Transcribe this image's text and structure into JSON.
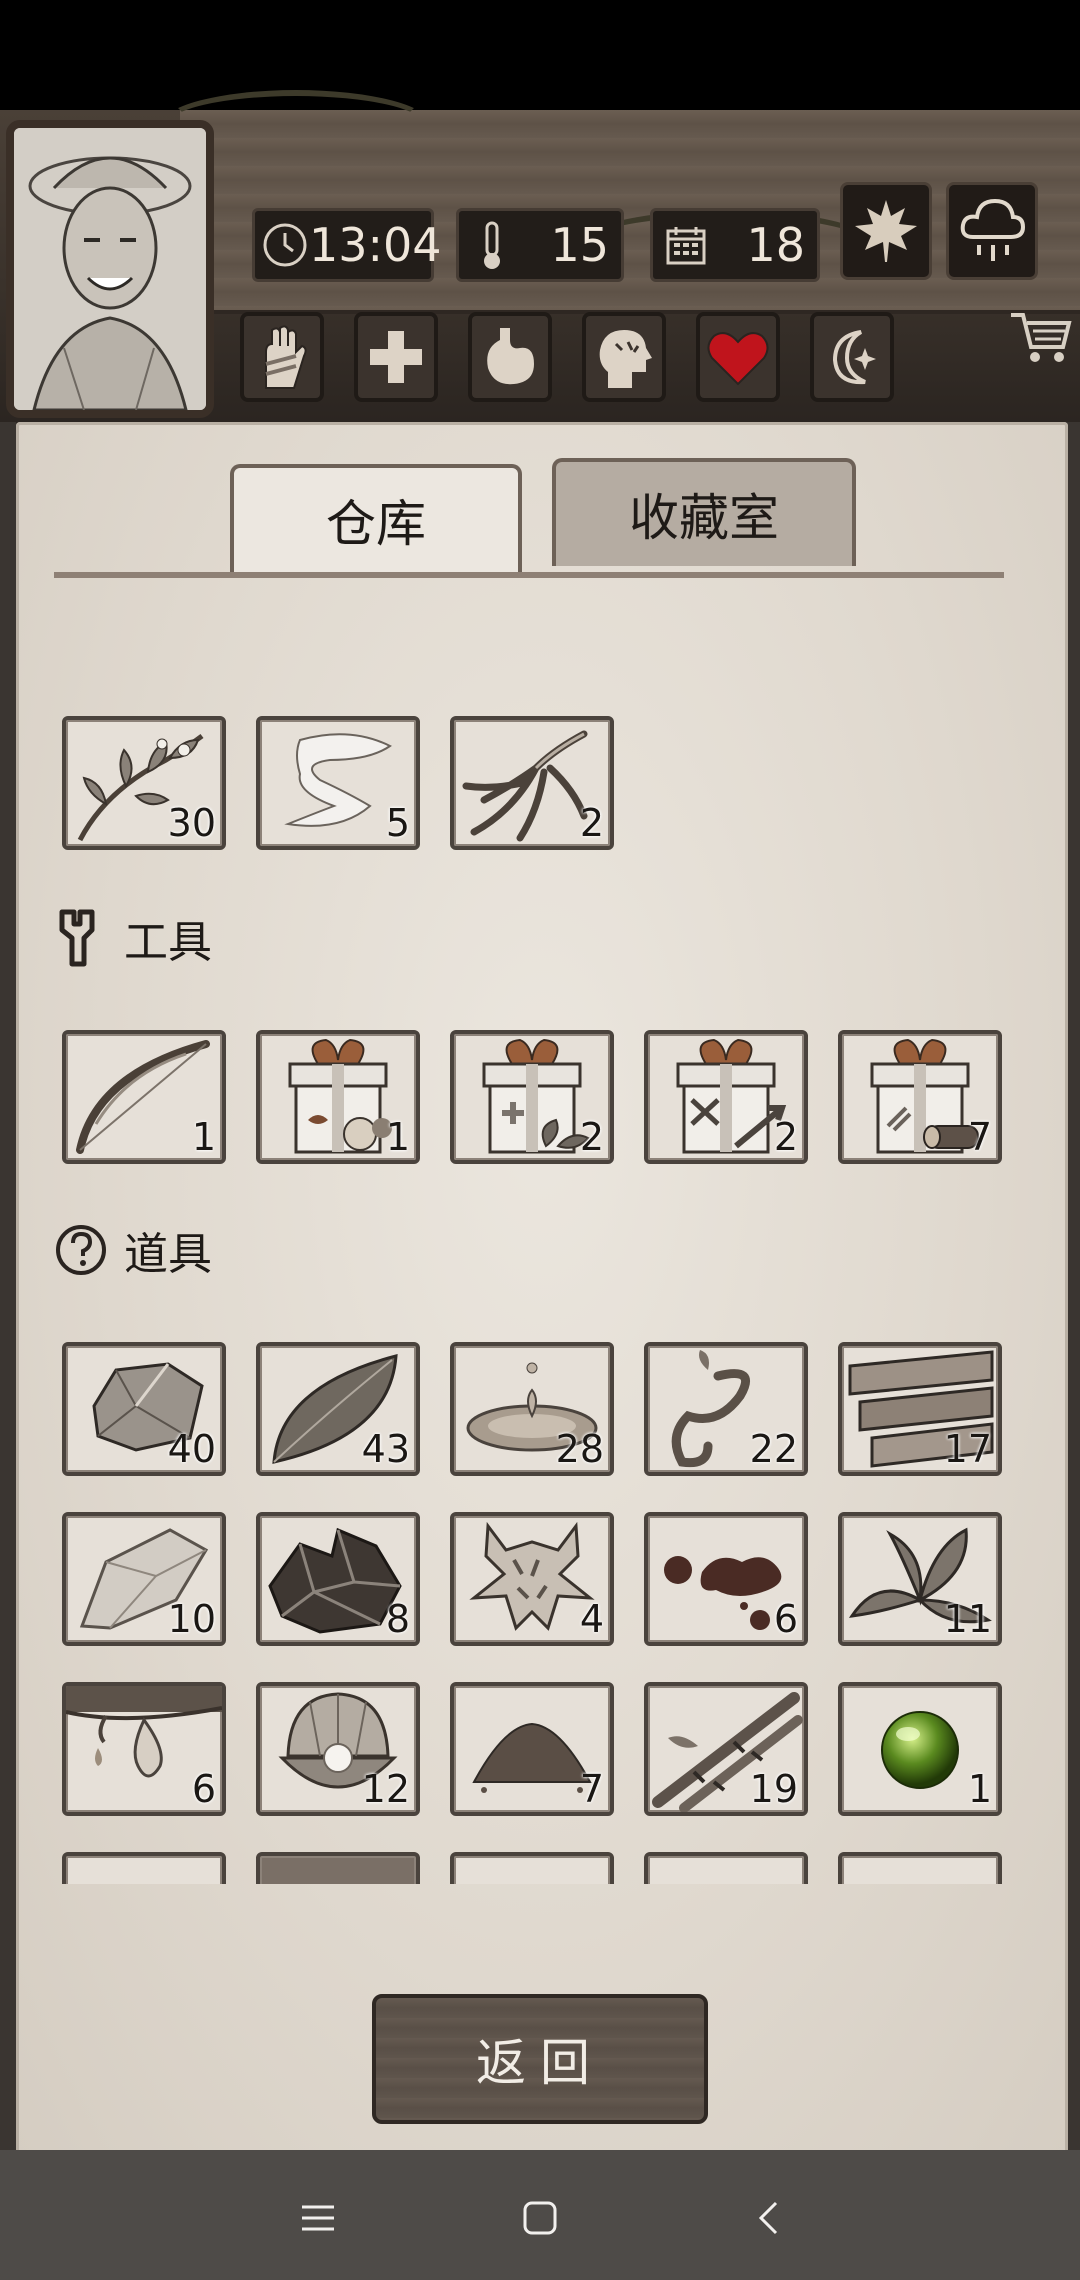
{
  "hud": {
    "time": "13:04",
    "temperature": "15",
    "day": "18"
  },
  "tabs": [
    {
      "label": "仓库",
      "active": true
    },
    {
      "label": "收藏室",
      "active": false
    }
  ],
  "groups": {
    "top_items": [
      {
        "icon": "herb-branch-icon",
        "count": "30"
      },
      {
        "icon": "cloth-strip-icon",
        "count": "5"
      },
      {
        "icon": "ginseng-root-icon",
        "count": "2"
      }
    ],
    "tools": {
      "title": "工具",
      "icon": "wrench-icon",
      "items": [
        {
          "icon": "bow-icon",
          "count": "1"
        },
        {
          "icon": "food-gift-box-icon",
          "count": "1"
        },
        {
          "icon": "medical-gift-box-icon",
          "count": "2"
        },
        {
          "icon": "weapon-gift-box-icon",
          "count": "2"
        },
        {
          "icon": "wood-gift-box-icon",
          "count": "7"
        }
      ]
    },
    "props": {
      "title": "道具",
      "icon": "question-circle-icon",
      "items": [
        {
          "icon": "stone-icon",
          "count": "40"
        },
        {
          "icon": "leaf-icon",
          "count": "43"
        },
        {
          "icon": "water-puddle-icon",
          "count": "28"
        },
        {
          "icon": "vine-icon",
          "count": "22"
        },
        {
          "icon": "wood-planks-icon",
          "count": "17"
        },
        {
          "icon": "flint-icon",
          "count": "10"
        },
        {
          "icon": "ore-icon",
          "count": "8"
        },
        {
          "icon": "animal-hide-icon",
          "count": "4"
        },
        {
          "icon": "blood-drops-icon",
          "count": "6"
        },
        {
          "icon": "mint-leaves-icon",
          "count": "11"
        },
        {
          "icon": "resin-drip-icon",
          "count": "6"
        },
        {
          "icon": "pearl-shell-icon",
          "count": "12"
        },
        {
          "icon": "soil-pile-icon",
          "count": "7"
        },
        {
          "icon": "bamboo-icon",
          "count": "19"
        },
        {
          "icon": "green-orb-icon",
          "count": "1"
        }
      ]
    }
  },
  "back_label": "返回",
  "colors": {
    "paper": "#e4ded5",
    "slot_border": "#4a433d",
    "heart": "#c0141c",
    "orb": "#5a8a1f"
  }
}
